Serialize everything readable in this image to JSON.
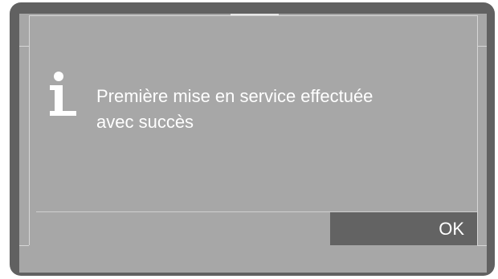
{
  "icons": {
    "info": "info-icon"
  },
  "colors": {
    "frame": "#616161",
    "screen": "#a7a7a7",
    "button": "#636363",
    "text": "#ffffff"
  },
  "dialog": {
    "message": "Première mise en service effectuée\navec succès",
    "ok_label": "OK"
  }
}
